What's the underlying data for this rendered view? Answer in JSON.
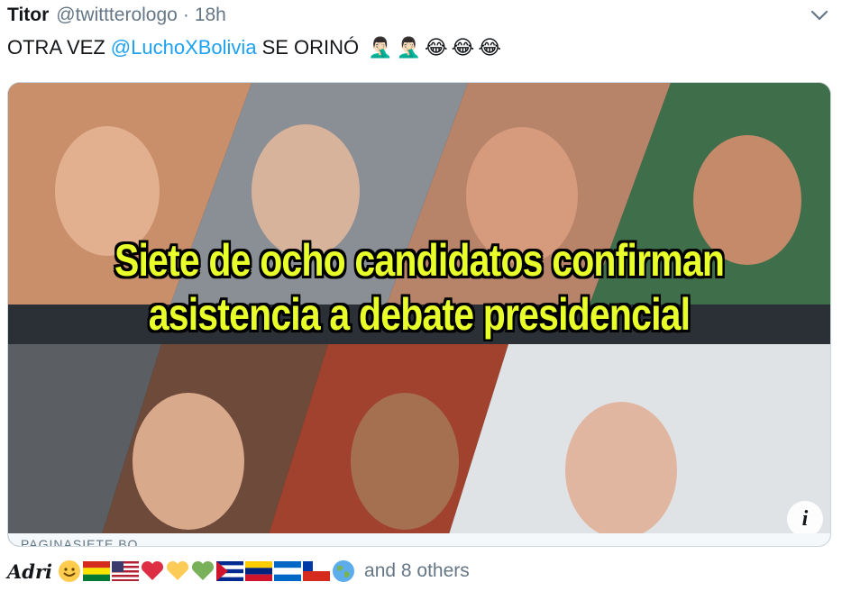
{
  "tweet": {
    "display_name": "Titor",
    "handle": "@twittterologo",
    "separator": "·",
    "time": "18h",
    "text_before": "OTRA VEZ",
    "mention": "@LuchoXBolivia",
    "text_after": "SE ORINÓ",
    "emojis": [
      "🤦🏻‍♂️",
      "🤦🏻‍♂️",
      "😂",
      "😂",
      "😂"
    ]
  },
  "media": {
    "caption_line1": "Siete de ocho candidatos confirman",
    "caption_line2": "asistencia a debate presidencial",
    "source_label": "PAGINASIETE.BO",
    "caption_color": "#e8ff2a",
    "info_icon": "i"
  },
  "likes": {
    "liker_name": "Adri",
    "others": "and 8 others",
    "icons": [
      "smiling-face-icon",
      "bolivia-flag-icon",
      "usa-flag-icon",
      "red-heart-icon",
      "yellow-heart-icon",
      "green-heart-icon",
      "cuba-flag-icon",
      "venezuela-flag-icon",
      "nicaragua-flag-icon",
      "chile-flag-icon",
      "globe-icon"
    ]
  },
  "colors": {
    "accent": "#1da1f2",
    "secondary_text": "#657786",
    "border": "#ccd6dd"
  }
}
